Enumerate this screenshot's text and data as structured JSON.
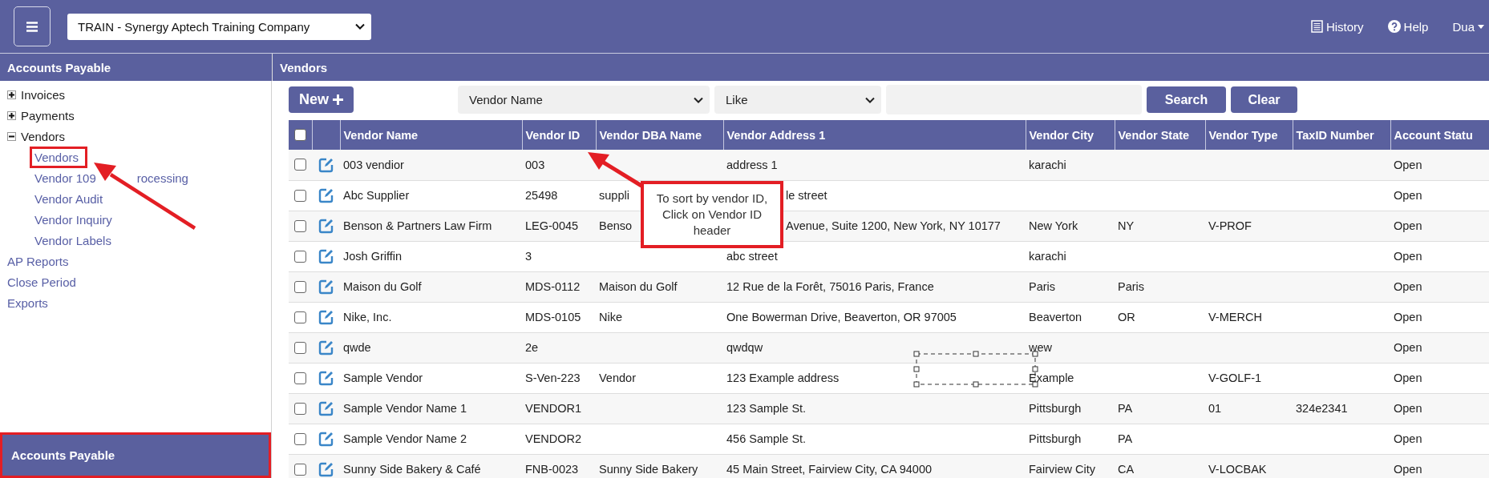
{
  "top_bar": {
    "company": "TRAIN - Synergy Aptech Training Company",
    "links": [
      {
        "kind": "history",
        "label": "History"
      },
      {
        "kind": "help",
        "label": "Help"
      },
      {
        "kind": "user",
        "label": "Dua"
      }
    ]
  },
  "sidebar": {
    "title": "Accounts Payable",
    "items": [
      {
        "label": "Invoices",
        "expanded": false
      },
      {
        "label": "Payments",
        "expanded": false
      },
      {
        "label": "Vendors",
        "expanded": true,
        "children": [
          {
            "label": "Vendors",
            "highlighted": true
          },
          {
            "label": "Vendor 109",
            "label_after_arrow": "rocessing",
            "highlighted": false
          },
          {
            "label": "Vendor Audit",
            "highlighted": false
          },
          {
            "label": "Vendor Inquiry",
            "highlighted": false
          },
          {
            "label": "Vendor Labels",
            "highlighted": false
          }
        ]
      },
      {
        "label": "AP Reports"
      },
      {
        "label": "Close Period"
      },
      {
        "label": "Exports"
      }
    ],
    "footer": {
      "label": "Accounts Payable",
      "highlighted": true
    }
  },
  "main": {
    "title": "Vendors",
    "new_button": "New",
    "search": {
      "field": "Vendor Name",
      "operator": "Like",
      "search_button": "Search",
      "clear_button": "Clear"
    },
    "table": {
      "header_checked": false,
      "columns": [
        "Vendor Name",
        "Vendor ID",
        "Vendor DBA Name",
        "Vendor Address 1",
        "Vendor City",
        "Vendor State",
        "Vendor Type",
        "TaxID Number",
        "Account Statu"
      ],
      "rows": [
        {
          "checked": false,
          "cells": [
            "003 vendior",
            "003",
            null,
            "address 1",
            "karachi",
            null,
            null,
            null,
            "Open"
          ]
        },
        {
          "checked": false,
          "cells": [
            "Abc Supplier",
            "25498",
            "suppli",
            {
              "text": "le street",
              "cut_start": true
            },
            null,
            null,
            null,
            null,
            "Open"
          ]
        },
        {
          "checked": false,
          "cells": [
            "Benson & Partners Law Firm",
            "LEG-0045",
            "Benso",
            {
              "text": "Avenue, Suite 1200, New York, NY 10177",
              "cut_start": true
            },
            "New York",
            "NY",
            "V-PROF",
            null,
            "Open"
          ]
        },
        {
          "checked": false,
          "cells": [
            "Josh Griffin",
            "3",
            null,
            "abc street",
            "karachi",
            null,
            null,
            null,
            "Open"
          ]
        },
        {
          "checked": false,
          "cells": [
            "Maison du Golf",
            "MDS-0112",
            "Maison du Golf",
            "12 Rue de la Forêt, 75016 Paris, France",
            "Paris",
            "Paris",
            null,
            null,
            "Open"
          ]
        },
        {
          "checked": false,
          "cells": [
            "Nike, Inc.",
            "MDS-0105",
            "Nike",
            "One Bowerman Drive, Beaverton, OR 97005",
            "Beaverton",
            "OR",
            "V-MERCH",
            null,
            "Open"
          ]
        },
        {
          "checked": false,
          "cells": [
            "qwde",
            "2e",
            null,
            "qwdqw",
            "wew",
            null,
            null,
            null,
            "Open"
          ]
        },
        {
          "checked": false,
          "cells": [
            "Sample Vendor",
            "S-Ven-223",
            "Vendor",
            "123 Example address",
            "Example",
            null,
            "V-GOLF-1",
            null,
            "Open"
          ]
        },
        {
          "checked": false,
          "cells": [
            "Sample Vendor Name 1",
            "VENDOR1",
            null,
            "123 Sample St.",
            "Pittsburgh",
            "PA",
            "01",
            "324e2341",
            "Open"
          ]
        },
        {
          "checked": false,
          "cells": [
            "Sample Vendor Name 2",
            "VENDOR2",
            null,
            "456 Sample St.",
            "Pittsburgh",
            "PA",
            null,
            null,
            "Open"
          ]
        },
        {
          "checked": false,
          "cells": [
            "Sunny Side Bakery & Café",
            "FNB-0023",
            "Sunny Side Bakery",
            "45 Main Street, Fairview City, CA 94000",
            "Fairview City",
            "CA",
            "V-LOCBAK",
            null,
            "Open"
          ]
        }
      ]
    }
  },
  "callout": {
    "text": "To sort by vendor ID, Click on Vendor ID header"
  }
}
